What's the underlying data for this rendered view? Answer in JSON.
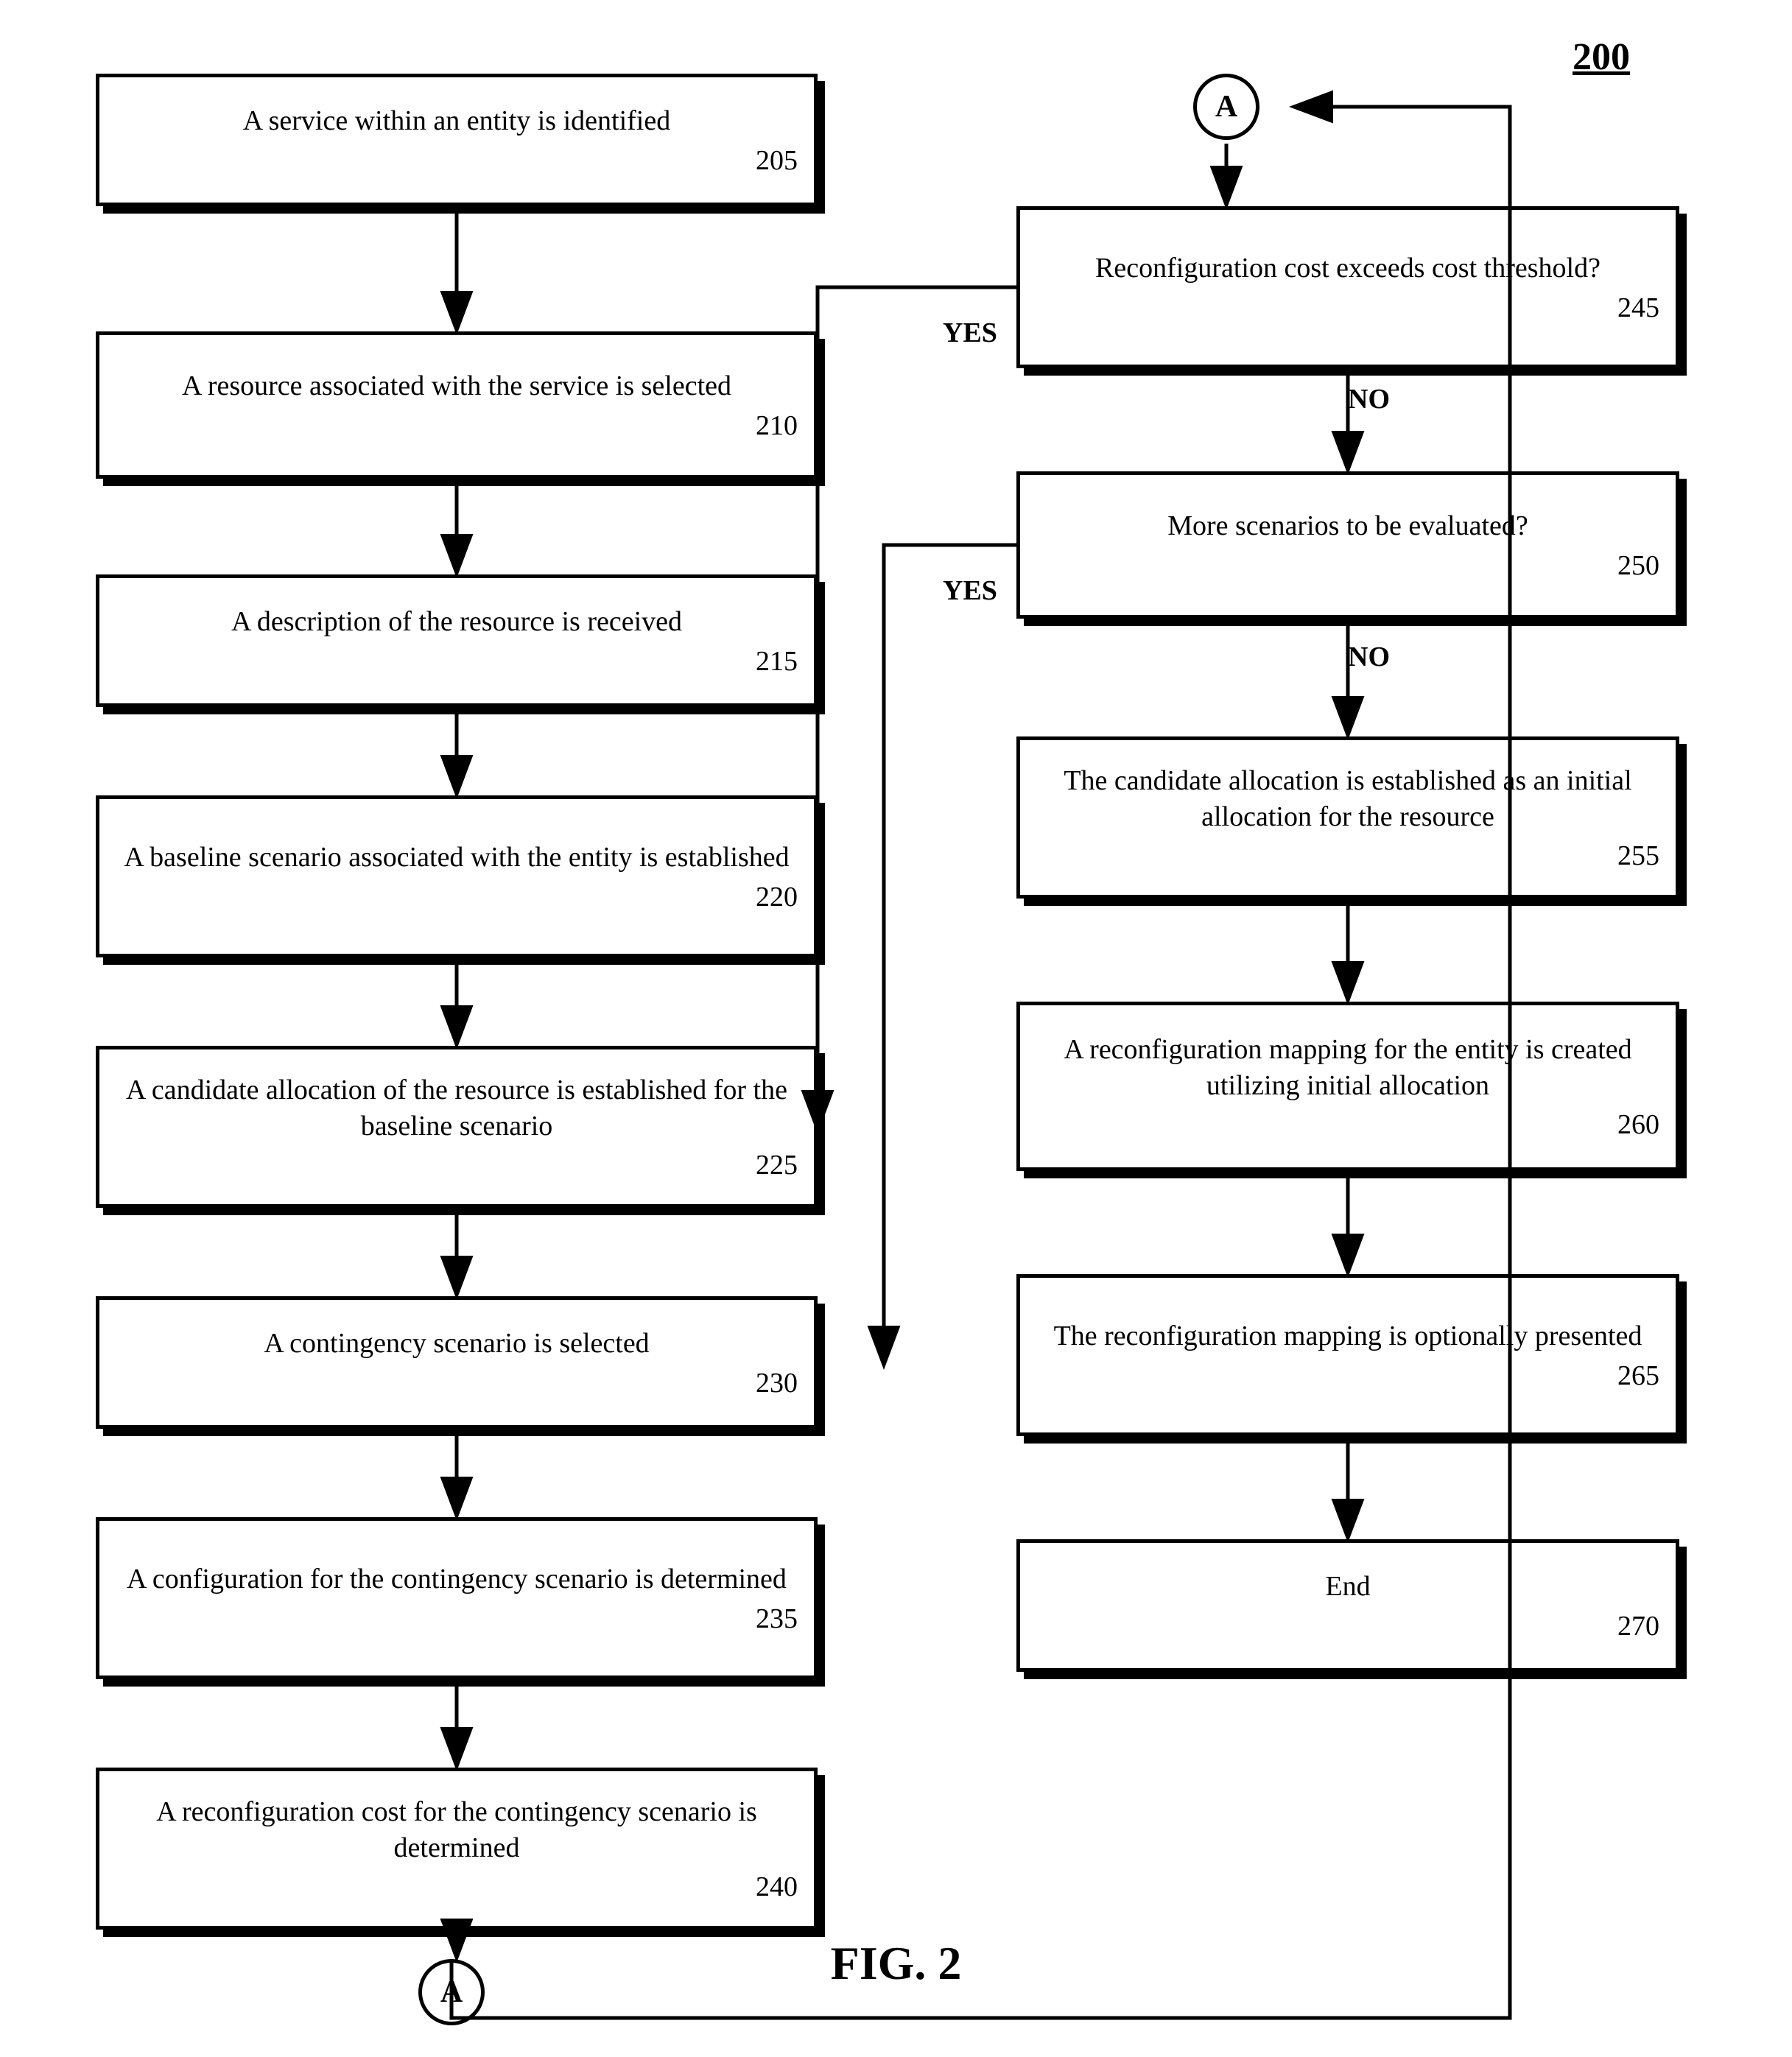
{
  "title": "200",
  "fig_label": "FIG. 2",
  "boxes": {
    "b205": {
      "label": "A service within an entity is identified",
      "num": "205"
    },
    "b210": {
      "label": "A resource associated with the service is selected",
      "num": "210"
    },
    "b215": {
      "label": "A description of the resource is received",
      "num": "215"
    },
    "b220": {
      "label": "A baseline scenario associated with the entity is established",
      "num": "220"
    },
    "b225": {
      "label": "A candidate allocation of the resource is established for the baseline scenario",
      "num": "225"
    },
    "b230": {
      "label": "A contingency scenario is selected",
      "num": "230"
    },
    "b235": {
      "label": "A configuration for the contingency scenario is determined",
      "num": "235"
    },
    "b240": {
      "label": "A reconfiguration cost for the contingency scenario is determined",
      "num": "240"
    },
    "b245": {
      "label": "Reconfiguration cost exceeds cost threshold?",
      "num": "245"
    },
    "b250": {
      "label": "More scenarios to be evaluated?",
      "num": "250"
    },
    "b255": {
      "label": "The candidate allocation is established as an initial allocation for the resource",
      "num": "255"
    },
    "b260": {
      "label": "A reconfiguration mapping for the entity is created utilizing initial allocation",
      "num": "260"
    },
    "b265": {
      "label": "The reconfiguration mapping is optionally presented",
      "num": "265"
    },
    "b270": {
      "label": "End",
      "num": "270"
    }
  },
  "connector_a": "A",
  "yes_label": "YES",
  "no_label": "NO"
}
